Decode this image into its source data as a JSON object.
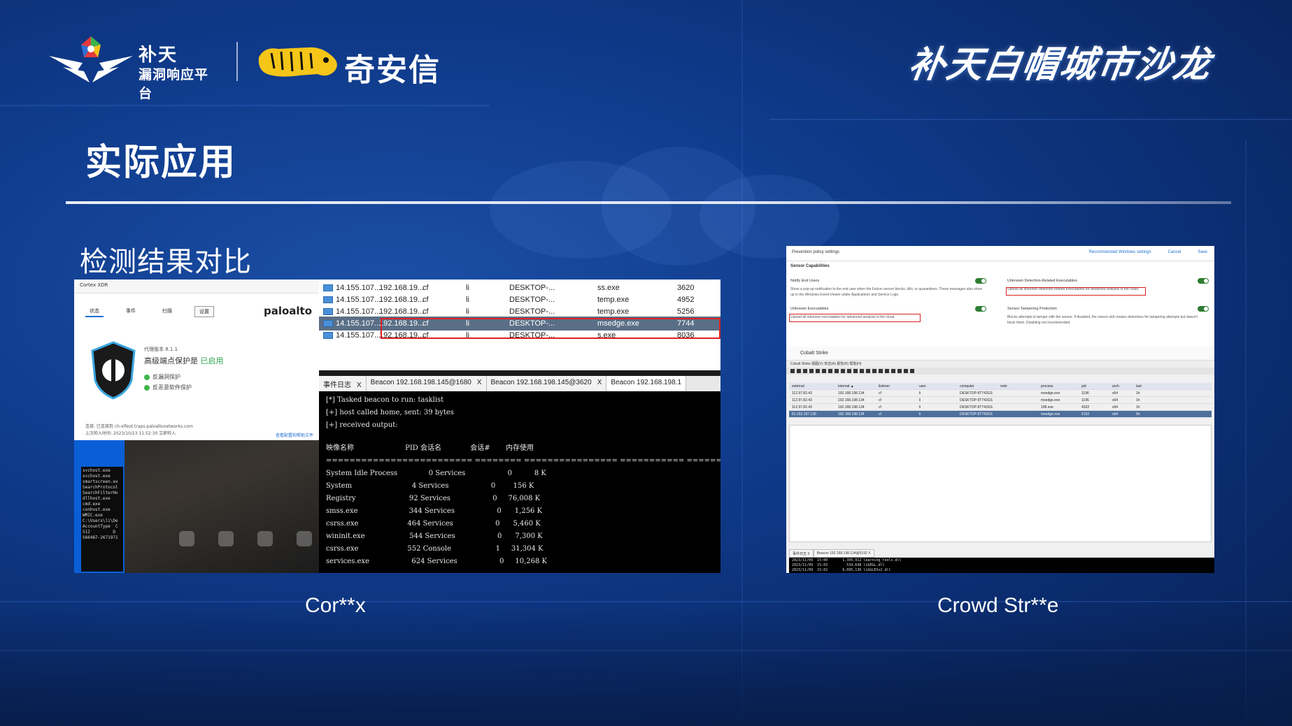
{
  "header": {
    "butian_line1": "补天",
    "butian_line2": "漏洞响应平台",
    "qax_name": "奇安信",
    "salon_title": "补天白帽城市沙龙"
  },
  "page_title": "实际应用",
  "section_title": "检测结果对比",
  "captions": {
    "left": "Cor**x",
    "right": "Crowd Str**e"
  },
  "xdr": {
    "window_title": "Cortex XDR",
    "tabs": [
      "状态",
      "事件",
      "扫描",
      "设置"
    ],
    "brand": "paloalto",
    "version": "代理版本 8.1.1",
    "status_prefix": "高级端点保护是",
    "status_value": "已启用",
    "features": [
      "反漏洞保护",
      "反恶意软件保护"
    ],
    "footer_line1": "连接:    已连接到 ch-xlfeot.traps.paloaltonetworks.com",
    "footer_line2": "上次检入时间:    2023/10/23 11:52:30    立即检入",
    "footer_link": "查看配置和帮助文件"
  },
  "cmd_lines": [
    "svchost.exe",
    "svchost.exe",
    "smartscreen.ex",
    "SearchProtocol",
    "SearchFilterHo",
    "dllhost.exe",
    "cmd.exe",
    "conhost.exe",
    "WMIC.exe",
    "",
    "C:\\Users\\li\\De",
    "AccountType  C",
    "",
    "512         D",
    "S66487-2671971"
  ],
  "processes": [
    {
      "external": "14.155.107....",
      "internal": "192.168.19...",
      "listener": "cf",
      "user": "li",
      "computer": "DESKTOP-...",
      "process": "ss.exe",
      "pid": "3620",
      "selected": false
    },
    {
      "external": "14.155.107....",
      "internal": "192.168.19...",
      "listener": "cf",
      "user": "li",
      "computer": "DESKTOP-...",
      "process": "temp.exe",
      "pid": "4952",
      "selected": false
    },
    {
      "external": "14.155.107....",
      "internal": "192.168.19...",
      "listener": "cf",
      "user": "li",
      "computer": "DESKTOP-...",
      "process": "temp.exe",
      "pid": "5256",
      "selected": false
    },
    {
      "external": "14.155.107...",
      "internal": "192.168.19...",
      "listener": "cf",
      "user": "li",
      "computer": "DESKTOP-...",
      "process": "msedge.exe",
      "pid": "7744",
      "selected": true
    },
    {
      "external": "14.155.107....",
      "internal": "192.168.19...",
      "listener": "cf",
      "user": "li",
      "computer": "DESKTOP-...",
      "process": "s.exe",
      "pid": "8036",
      "selected": false
    }
  ],
  "beacon_tabs": [
    {
      "label": "事件日志",
      "close": "X"
    },
    {
      "label": "Beacon 192.168.198.145@1680",
      "close": "X"
    },
    {
      "label": "Beacon 192.168.198.145@3620",
      "close": "X"
    },
    {
      "label": "Beacon 192.168.198.1",
      "close": ""
    }
  ],
  "terminal": {
    "lines": [
      "[*] Tasked beacon to run: tasklist",
      "[+] host called home, sent: 39 bytes",
      "[+] received output:",
      "",
      "映像名称                       PID 会话名             会话#       内存使用",
      "========================= ======== ================ =========== ============",
      "System Idle Process              0 Services                   0          8 K",
      "System                           4 Services                   0        156 K",
      "Registry                        92 Services                   0     76,008 K",
      "smss.exe                       344 Services                   0      1,256 K",
      "csrss.exe                      464 Services                   0      5,460 K",
      "wininit.exe                    544 Services                   0      7,300 K",
      "csrss.exe                      552 Console                    1     31,304 K",
      "services.exe                   624 Services                   0     10,268 K"
    ]
  },
  "crowdstrike": {
    "header": "Prevention policy settings",
    "header_buttons": [
      "Recommended Windows settings",
      "Cancel",
      "Save"
    ],
    "section": "Sensor Capabilities",
    "options": [
      {
        "title": "Notify End Users",
        "desc": "Show a pop-up notification to the end user when the Falcon sensor blocks, kills, or quarantines. These messages also show up in the Windows Event Viewer under Applications and Service Logs."
      },
      {
        "title": "Unknown Detection-Related Executables",
        "desc": "Upload all unknown detection-related executables for advanced analysis in the cloud."
      },
      {
        "title": "Unknown Executables",
        "desc": "Upload all unknown executables for advanced analysis in the cloud."
      },
      {
        "title": "Sensor Tampering Protection",
        "desc": "Blocks attempts to tamper with the sensor. If disabled, the sensor still creates detections for tampering attempts but doesn't block them. Disabling not recommended."
      }
    ],
    "cs_title": "Cobalt Strike",
    "cs_menu": "Cobalt Strike  视图(V)  攻击(A)  报告(R)  帮助(H)",
    "columns": [
      "external",
      "internal ▲",
      "listener",
      "user",
      "computer",
      "note",
      "process",
      "pid",
      "arch",
      "last"
    ],
    "rows": [
      [
        "112.97.82.43",
        "192.168.198.134",
        "cf",
        "li",
        "DESKTOP-9T742GS",
        "",
        "msedge.exe",
        "1196",
        "x64",
        "1h"
      ],
      [
        "112.97.82.43",
        "192.168.198.134",
        "cf",
        "li",
        "DESKTOP-9T742GS",
        "",
        "msedge.exe",
        "1196",
        "x64",
        "1h"
      ],
      [
        "112.97.82.43",
        "192.168.198.134",
        "cf",
        "li",
        "DESKTOP-9T742GS",
        "",
        "198.exe",
        "4332",
        "x64",
        "1h"
      ],
      [
        "61.152.197.139",
        "192.168.198.134",
        "cf",
        "li",
        "DESKTOP-9T742GS",
        "",
        "msedge.exe",
        "5192",
        "x64",
        "5h"
      ]
    ],
    "tabs": [
      "事件日志 X",
      "Beacon 192.168.198.134@5192 X"
    ],
    "terminal_lines": [
      "2023/11/09  15:00       1,395,912 learning_tools.dll",
      "2023/11/09  15:03         534,648 libEGL.dll",
      "2023/11/09  15:02       6,095,136 libGLESv2.dll",
      "2023/11/09  15:00       2,772,432 libsmartscreen.dll",
      "2023/11/13  10:12    <DIR>          locales"
    ]
  },
  "colors": {
    "accent_green": "#2ea44f",
    "highlight_red": "#e02020"
  }
}
